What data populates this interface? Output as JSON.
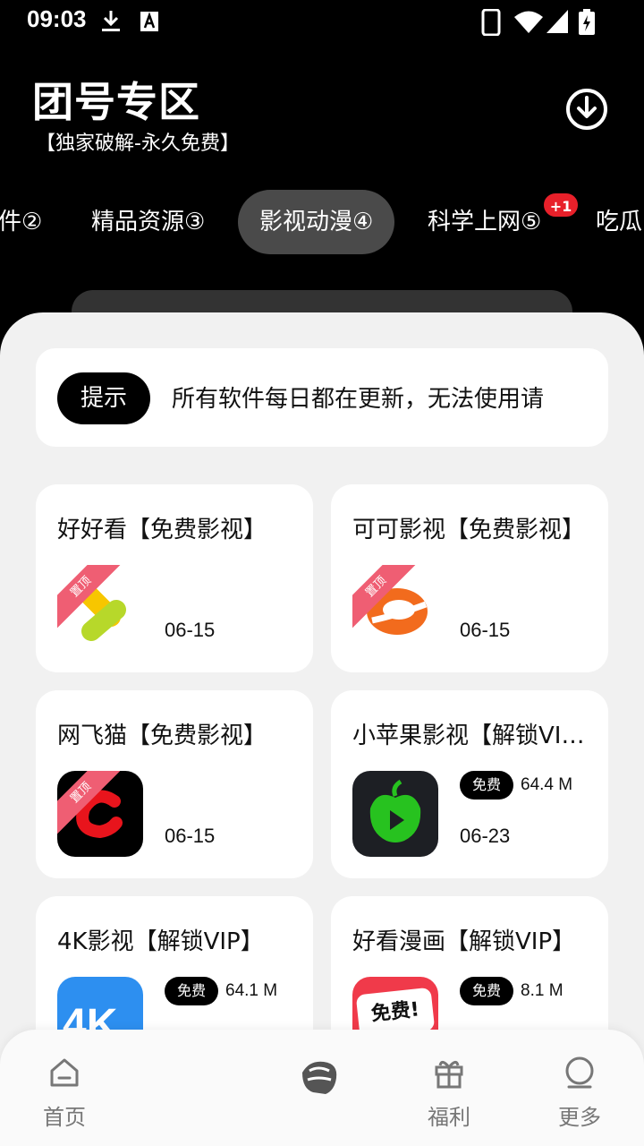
{
  "status_bar": {
    "time": "09:03",
    "icons": [
      "download-icon",
      "a-icon",
      "phone-icon",
      "wifi-icon",
      "signal-icon",
      "battery-icon"
    ]
  },
  "header": {
    "title": "团号专区",
    "subtitle": "【独家破解-永久免费】",
    "download_icon": "download-circle-icon"
  },
  "tabs": [
    {
      "label": "件②"
    },
    {
      "label": "精品资源③"
    },
    {
      "label": "影视动漫④",
      "active": true
    },
    {
      "label": "科学上网⑤",
      "badge": "+1"
    },
    {
      "label": "吃瓜"
    }
  ],
  "notice": {
    "tag": "提示",
    "text": "所有软件每日都在更新，无法使用请"
  },
  "apps": [
    {
      "title": "好好看【免费影视】",
      "date": "06-15",
      "pinned": true,
      "ribbon": "置顶"
    },
    {
      "title": "可可影视【免费影视】",
      "date": "06-15",
      "pinned": true,
      "ribbon": "置顶"
    },
    {
      "title": "网飞猫【免费影视】",
      "date": "06-15",
      "pinned": true,
      "ribbon": "置顶"
    },
    {
      "title": "小苹果影视【解锁VIP】",
      "date": "06-23",
      "free_tag": "免费",
      "size": "64.4 M"
    },
    {
      "title": "4K影视【解锁VIP】",
      "free_tag": "免费",
      "size": "64.1 M",
      "icon_text": "4K"
    },
    {
      "title": "好看漫画【解锁VIP】",
      "free_tag": "免费",
      "size": "8.1 M",
      "icon_text": "免费!"
    }
  ],
  "bottom_nav": {
    "items": [
      {
        "label": "首页",
        "icon": "home-icon"
      },
      {
        "label": "福利",
        "icon": "gift-icon"
      },
      {
        "label": "更多",
        "icon": "user-icon"
      }
    ]
  }
}
